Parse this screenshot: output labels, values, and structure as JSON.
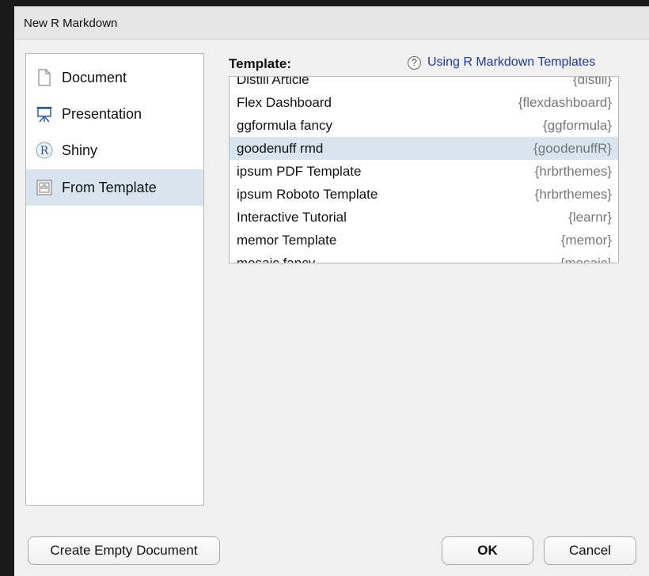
{
  "window": {
    "title": "New R Markdown"
  },
  "sidebar": {
    "items": [
      {
        "label": "Document",
        "icon": "document-icon",
        "selected": false
      },
      {
        "label": "Presentation",
        "icon": "presentation-icon",
        "selected": false
      },
      {
        "label": "Shiny",
        "icon": "shiny-icon",
        "selected": false
      },
      {
        "label": "From Template",
        "icon": "template-icon",
        "selected": true
      }
    ]
  },
  "templates": {
    "header": "Template:",
    "help_link": "Using R Markdown Templates",
    "help_icon": "?",
    "rows": [
      {
        "name": "Distill Article",
        "package": "{distill}"
      },
      {
        "name": "Flex Dashboard",
        "package": "{flexdashboard}"
      },
      {
        "name": "ggformula fancy",
        "package": "{ggformula}"
      },
      {
        "name": "goodenuff rmd",
        "package": "{goodenuffR}"
      },
      {
        "name": "ipsum PDF Template",
        "package": "{hrbrthemes}"
      },
      {
        "name": "ipsum Roboto Template",
        "package": "{hrbrthemes}"
      },
      {
        "name": "Interactive Tutorial",
        "package": "{learnr}"
      },
      {
        "name": "memor Template",
        "package": "{memor}"
      },
      {
        "name": "mosaic fancy",
        "package": "{mosaic}"
      }
    ],
    "selected_name": "goodenuff rmd"
  },
  "buttons": {
    "create_empty": "Create Empty Document",
    "ok": "OK",
    "cancel": "Cancel"
  },
  "colors": {
    "selection": "#d8e4ee",
    "link": "#1a3aa8",
    "package_text": "#777777"
  }
}
